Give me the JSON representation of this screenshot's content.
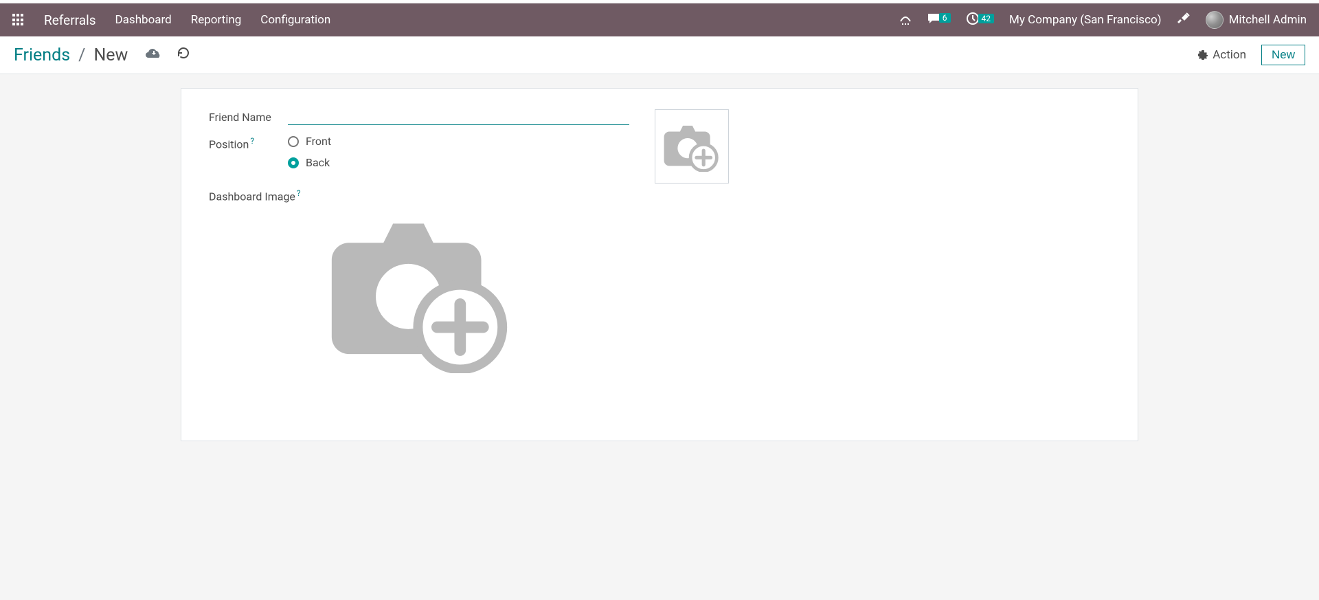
{
  "navbar": {
    "brand": "Referrals",
    "menu": [
      "Dashboard",
      "Reporting",
      "Configuration"
    ],
    "messaging_count": "6",
    "activities_count": "42",
    "company": "My Company (San Francisco)",
    "user_name": "Mitchell Admin"
  },
  "control_panel": {
    "breadcrumb_root": "Friends",
    "breadcrumb_sep": "/",
    "breadcrumb_current": "New",
    "action_label": "Action",
    "new_btn": "New"
  },
  "form": {
    "friend_name_label": "Friend Name",
    "friend_name_value": "",
    "position_label": "Position",
    "position_help": "?",
    "position_options": {
      "front": "Front",
      "back": "Back"
    },
    "position_selected": "back",
    "dashboard_image_label": "Dashboard Image",
    "dashboard_image_help": "?"
  },
  "colors": {
    "primary": "#017e84",
    "nav_bg": "#6f5a63",
    "teal": "#00a09d"
  }
}
